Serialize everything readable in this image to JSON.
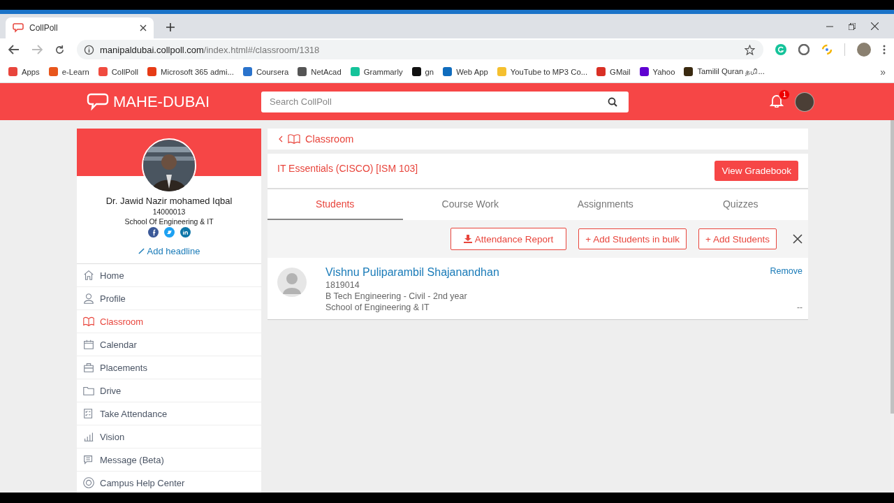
{
  "browser": {
    "tab_title": "CollPoll",
    "url_host": "manipaldubai.collpoll.com",
    "url_path": "/index.html#/classroom/1318",
    "bookmarks": [
      {
        "label": "Apps",
        "color": "#e8453c"
      },
      {
        "label": "e-Learn",
        "color": "#e8561c"
      },
      {
        "label": "CollPoll",
        "color": "#f04b3f"
      },
      {
        "label": "Microsoft 365 admi...",
        "color": "#e63b16"
      },
      {
        "label": "Coursera",
        "color": "#2a73cc"
      },
      {
        "label": "NetAcad",
        "color": "#555555"
      },
      {
        "label": "Grammarly",
        "color": "#15c39a"
      },
      {
        "label": "gn",
        "color": "#111111"
      },
      {
        "label": "Web App",
        "color": "#0f6cbd"
      },
      {
        "label": "YouTube to MP3 Co...",
        "color": "#f5c02f"
      },
      {
        "label": "GMail",
        "color": "#d93025"
      },
      {
        "label": "Yahoo",
        "color": "#5f01d1"
      },
      {
        "label": "Tamilil Quran தமி...",
        "color": "#3a2a10"
      }
    ],
    "more": "»"
  },
  "app": {
    "brand": "MAHE-DUBAI",
    "search_placeholder": "Search CollPoll",
    "notifications": "1"
  },
  "profile": {
    "name": "Dr. Jawid Nazir mohamed Iqbal",
    "id": "14000013",
    "school": "School Of Engineering & IT",
    "add_headline": "Add headline"
  },
  "nav": [
    {
      "label": "Home",
      "selected": false
    },
    {
      "label": "Profile",
      "selected": false
    },
    {
      "label": "Classroom",
      "selected": true
    },
    {
      "label": "Calendar",
      "selected": false
    },
    {
      "label": "Placements",
      "selected": false
    },
    {
      "label": "Drive",
      "selected": false
    },
    {
      "label": "Take Attendance",
      "selected": false
    },
    {
      "label": "Vision",
      "selected": false
    },
    {
      "label": "Message (Beta)",
      "selected": false
    },
    {
      "label": "Campus Help Center",
      "selected": false
    }
  ],
  "breadcrumb": "Classroom",
  "course": {
    "title": "IT Essentials (CISCO) [ISM 103]",
    "gradebook": "View Gradebook"
  },
  "tabs": [
    {
      "label": "Students",
      "selected": true
    },
    {
      "label": "Course Work",
      "selected": false
    },
    {
      "label": "Assignments",
      "selected": false
    },
    {
      "label": "Quizzes",
      "selected": false
    }
  ],
  "actions": [
    {
      "label": "Attendance Report",
      "kind": "download"
    },
    {
      "label": "+ Add Students in bulk",
      "kind": "add"
    },
    {
      "label": "+ Add Students",
      "kind": "add"
    }
  ],
  "students": [
    {
      "name": "Vishnu Puliparambil Shajanandhan",
      "id": "1819014",
      "program": "B Tech Engineering - Civil - 2nd year",
      "school": "School of Engineering & IT",
      "remove": "Remove",
      "note": "--"
    }
  ]
}
